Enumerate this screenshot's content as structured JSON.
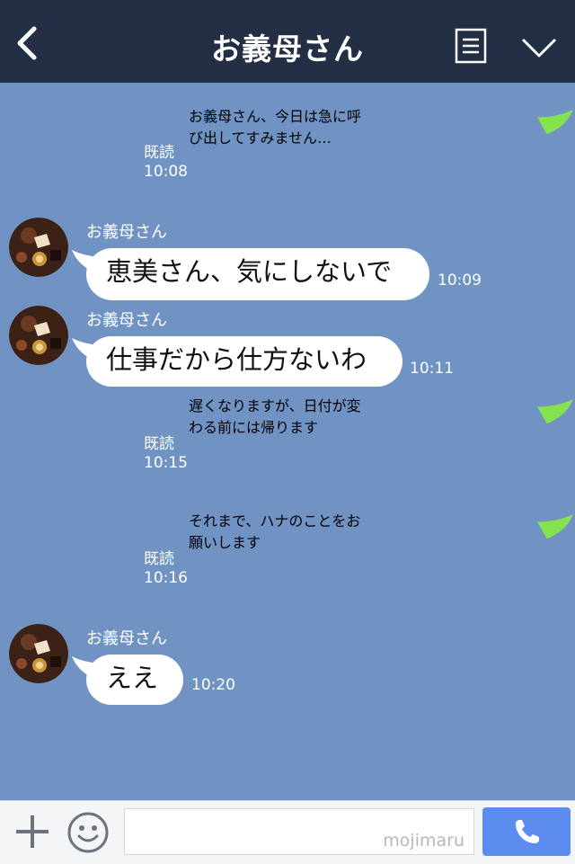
{
  "header": {
    "title": "お義母さん",
    "icons": [
      "chevron-left-icon",
      "list-menu-icon",
      "chevron-down-icon"
    ]
  },
  "messages": [
    {
      "direction": "out",
      "text_lines": [
        "お義母さん、今日は急に呼",
        "び出してすみません…"
      ],
      "read": "既読",
      "time": "10:08"
    },
    {
      "direction": "in",
      "sender": "お義母さん",
      "text": "恵美さん、気にしないで",
      "time": "10:09"
    },
    {
      "direction": "in",
      "sender": "お義母さん",
      "text": "仕事だから仕方ないわ",
      "time": "10:11"
    },
    {
      "direction": "out",
      "text_lines": [
        "遅くなりますが、日付が変",
        "わる前には帰ります"
      ],
      "read": "既読",
      "time": "10:15"
    },
    {
      "direction": "out",
      "text_lines": [
        "それまで、ハナのことをお",
        "願いします"
      ],
      "read": "既読",
      "time": "10:16"
    },
    {
      "direction": "in",
      "sender": "お義母さん",
      "text": "ええ",
      "time": "10:20"
    }
  ],
  "footer": {
    "input_value": "",
    "watermark": "mojimaru",
    "icons": [
      "plus-icon",
      "emoji-icon",
      "phone-icon"
    ]
  },
  "colors": {
    "header_bg": "#232f45",
    "chat_bg": "#7093c3",
    "outgoing_bubble": "#84e24f",
    "incoming_bubble": "#ffffff",
    "call_button": "#5b8df0"
  }
}
